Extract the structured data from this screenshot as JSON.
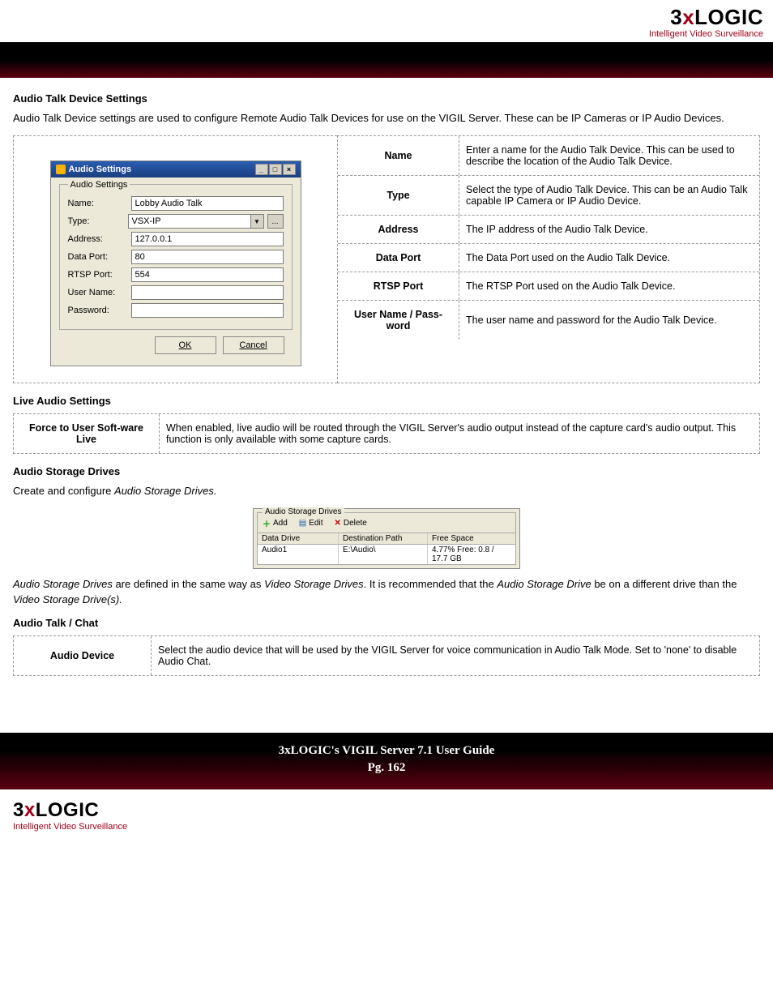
{
  "brand": {
    "three": "3",
    "x": "x",
    "rest": "LOGIC",
    "tagline": "Intelligent Video Surveillance"
  },
  "sections": {
    "s1_title": "Audio Talk Device Settings",
    "s1_para": "Audio Talk Device settings are used to configure Remote Audio Talk Devices for use on the VIGIL Server.  These can be IP Cameras or IP Audio Devices.",
    "s2_title": "Live Audio Settings",
    "s3_title": "Audio Storage Drives",
    "s3_para": "Create and configure Audio Storage Drives.",
    "s3_para2_a": "Audio Storage Drives",
    "s3_para2_b": " are defined in the same way as ",
    "s3_para2_c": "Video Storage Drives",
    "s3_para2_d": ". It is recommended that the ",
    "s3_para2_e": "Audio Storage Drive",
    "s3_para2_f": " be on a different drive than the ",
    "s3_para2_g": "Video Storage Drive(s).",
    "s4_title": "Audio Talk / Chat"
  },
  "dialog": {
    "title": "Audio Settings",
    "legend": "Audio Settings",
    "labels": {
      "name": "Name:",
      "type": "Type:",
      "address": "Address:",
      "dataport": "Data Port:",
      "rtspport": "RTSP Port:",
      "username": "User Name:",
      "password": "Password:"
    },
    "values": {
      "name": "Lobby Audio Talk",
      "type": "VSX-IP",
      "address": "127.0.0.1",
      "dataport": "80",
      "rtspport": "554",
      "username": "",
      "password": ""
    },
    "buttons": {
      "ok": "OK",
      "cancel": "Cancel"
    },
    "winbtns": {
      "min": "_",
      "max": "□",
      "close": "×"
    }
  },
  "table1": [
    {
      "label": "Name",
      "desc": "Enter a name for the Audio Talk Device. This can be used to describe the location of the Audio Talk Device."
    },
    {
      "label": "Type",
      "desc": "Select the type of Audio Talk Device.  This can be an Audio Talk capable IP Camera or IP Audio Device."
    },
    {
      "label": "Address",
      "desc": "The IP address of the Audio Talk Device."
    },
    {
      "label": "Data Port",
      "desc": "The Data Port used on the Audio Talk Device."
    },
    {
      "label": "RTSP Port",
      "desc": "The RTSP Port used on the Audio Talk Device."
    },
    {
      "label": "User Name / Pass-word",
      "desc": "The user name and password for the Audio Talk Device."
    }
  ],
  "live_table": {
    "label": "Force to User Soft-ware Live",
    "desc": "When enabled, live audio will be routed through the VIGIL Server's audio output instead of the capture card's audio output.   This function is only available with some capture cards."
  },
  "storage": {
    "legend": "Audio Storage Drives",
    "toolbar": {
      "add": "Add",
      "edit": "Edit",
      "delete": "Delete"
    },
    "head": {
      "c1": "Data Drive",
      "c2": "Destination Path",
      "c3": "Free Space"
    },
    "row": {
      "c1": "Audio1",
      "c2": "E:\\Audio\\",
      "c3": "4.77% Free: 0.8 / 17.7 GB"
    }
  },
  "chat_table": {
    "label": "Audio Device",
    "desc": "Select the audio device that will be used by the VIGIL Server for voice communication in Audio Talk Mode.  Set to 'none' to disable Audio Chat."
  },
  "footer": {
    "line1": "3xLOGIC's VIGIL Server 7.1 User Guide",
    "line2": "Pg. 162"
  }
}
